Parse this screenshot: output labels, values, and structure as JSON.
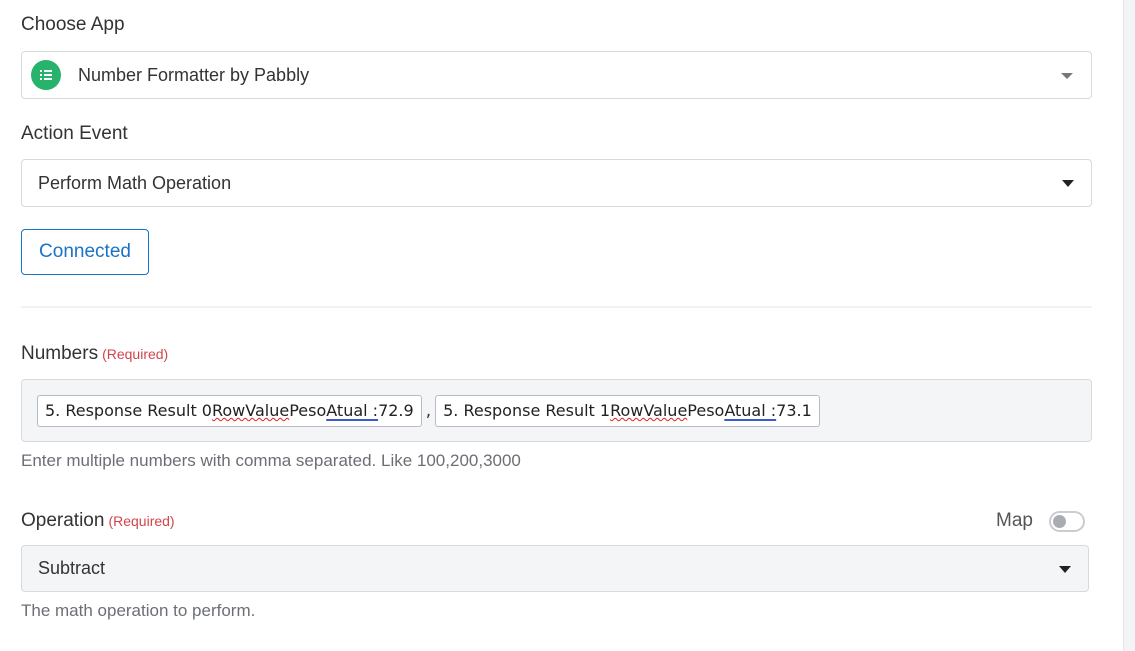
{
  "choose_app": {
    "label": "Choose App",
    "selected": "Number Formatter by Pabbly",
    "icon": "list-icon",
    "icon_color": "#27b36b"
  },
  "action_event": {
    "label": "Action Event",
    "selected": "Perform Math Operation"
  },
  "connection": {
    "button_label": "Connected",
    "accent": "#1a73c8"
  },
  "numbers": {
    "label": "Numbers",
    "required": "(Required)",
    "chips": [
      {
        "prefix": "5. Response Result 0 ",
        "word1": "RowValue",
        "mid": " Peso ",
        "word2": "Atual :",
        "value": " 72.9"
      },
      {
        "prefix": "5. Response Result 1 ",
        "word1": "RowValue",
        "mid": " Peso ",
        "word2": "Atual :",
        "value": " 73.1"
      }
    ],
    "separator": ",",
    "help": "Enter multiple numbers with comma separated. Like 100,200,3000"
  },
  "operation": {
    "label": "Operation",
    "required": "(Required)",
    "map_label": "Map",
    "map_enabled": false,
    "selected": "Subtract",
    "help": "The math operation to perform."
  }
}
